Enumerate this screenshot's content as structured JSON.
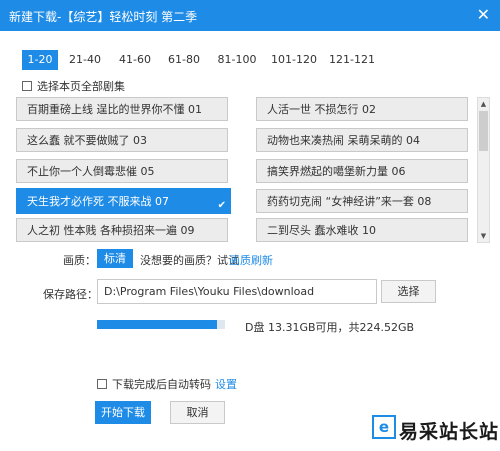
{
  "window": {
    "title": "新建下载-【综艺】轻松时刻 第二季",
    "close_glyph": "✕"
  },
  "tabs": [
    {
      "label": "1-20",
      "active": true
    },
    {
      "label": "21-40",
      "active": false
    },
    {
      "label": "41-60",
      "active": false
    },
    {
      "label": "61-80",
      "active": false
    },
    {
      "label": "81-100",
      "active": false
    },
    {
      "label": "101-120",
      "active": false
    },
    {
      "label": "121-121",
      "active": false
    }
  ],
  "select_all_label": "选择本页全部剧集",
  "episodes": [
    {
      "label": "百期重磅上线 逞比的世界你不懂 01",
      "selected": false
    },
    {
      "label": "人活一世 不损怎行 02",
      "selected": false
    },
    {
      "label": "这么蠢 就不要做贼了 03",
      "selected": false
    },
    {
      "label": "动物也来凑热闹 呆萌呆萌的 04",
      "selected": false
    },
    {
      "label": "不止你一个人倒霉悲催 05",
      "selected": false
    },
    {
      "label": "搞笑界燃起的噶堡新力量 06",
      "selected": false
    },
    {
      "label": "天生我才必作死 不服来战 07",
      "selected": true
    },
    {
      "label": "药药切克闹 “女神经讲”来一套 08",
      "selected": false
    },
    {
      "label": "人之初 性本贱 各种损招来一遍 09",
      "selected": false
    },
    {
      "label": "二到尽头 蠢水难收 10",
      "selected": false
    }
  ],
  "episode_check_glyph": "✔",
  "quality": {
    "label": "画质：",
    "current": "标清",
    "hint": "没想要的画质？试试",
    "link": "画质刷新"
  },
  "path": {
    "label": "保存路径：",
    "value": "D:\\Program Files\\Youku Files\\download",
    "browse": "选择"
  },
  "disk": {
    "used_fraction": 0.94,
    "text": "D盘 13.31GB可用，共224.52GB"
  },
  "transcode": {
    "label": "下载完成后自动转码",
    "link": "设置"
  },
  "buttons": {
    "start": "开始下载",
    "cancel": "取消"
  },
  "scroll": {
    "up_glyph": "▲",
    "down_glyph": "▼"
  },
  "watermark": {
    "logo_glyph": "e",
    "text": "易采站长站"
  }
}
